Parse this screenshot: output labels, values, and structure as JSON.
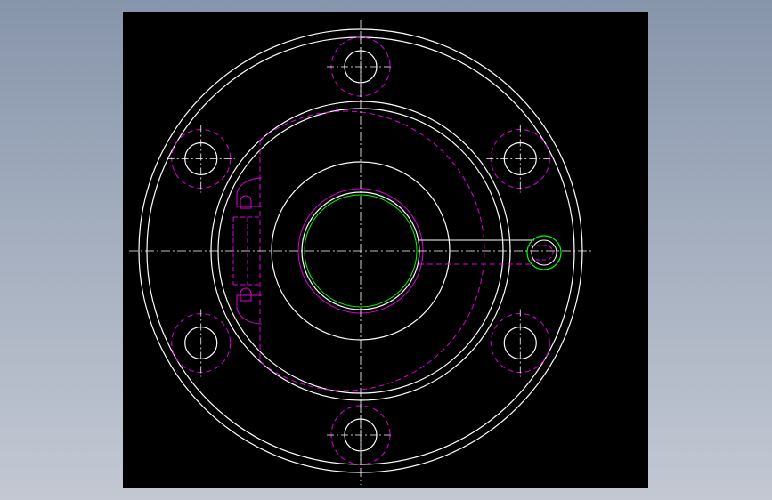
{
  "drawing": {
    "kind": "flange-part-top-view",
    "background_color": "#000000",
    "colors": {
      "outline": "#ffffff",
      "hidden": "#e000e0",
      "centerline": "#ffffff",
      "accent": "#00ff00"
    },
    "bolt_hole_count": 6,
    "features": [
      "outer-flange-rim",
      "body-boss",
      "center-bore",
      "six-bolt-holes",
      "side-port",
      "hidden-keyway",
      "hidden-pockets"
    ]
  }
}
